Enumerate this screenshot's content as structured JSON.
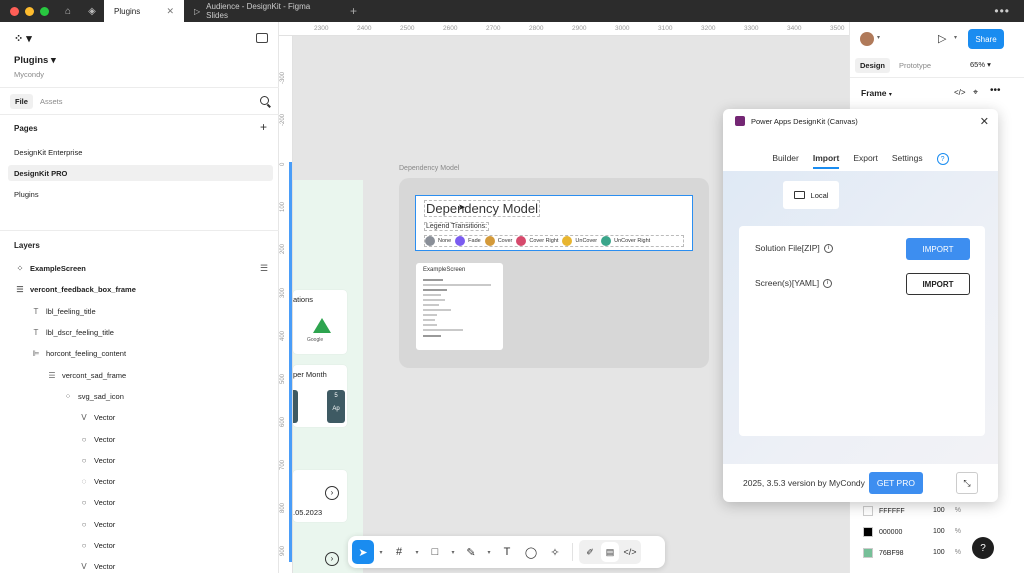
{
  "window": {
    "tabs": [
      {
        "label": "Plugins",
        "active": true
      },
      {
        "label": "Audience - DesignKit - Figma Slides",
        "active": false
      }
    ]
  },
  "file": {
    "name": "Plugins",
    "team": "Mycondy"
  },
  "left_tabs": {
    "file": "File",
    "assets": "Assets"
  },
  "pages": {
    "title": "Pages",
    "items": [
      "DesignKit Enterprise",
      "DesignKit PRO",
      "Plugins"
    ],
    "selected": "DesignKit PRO"
  },
  "layers": {
    "title": "Layers",
    "items": [
      {
        "name": "ExampleScreen",
        "icon": "component-grid-icon"
      },
      {
        "name": "vercont_feedback_box_frame",
        "icon": "frame-icon"
      },
      {
        "name": "lbl_feeling_title",
        "icon": "text-icon"
      },
      {
        "name": "lbl_dscr_feeling_title",
        "icon": "text-icon"
      },
      {
        "name": "horcont_feeling_content",
        "icon": "horizontal-layout-icon"
      },
      {
        "name": "vercont_sad_frame",
        "icon": "frame-icon"
      },
      {
        "name": "svg_sad_icon",
        "icon": "component-grid-icon"
      },
      {
        "name": "Vector",
        "icon": "vector-icon"
      },
      {
        "name": "Vector",
        "icon": "vector-icon"
      },
      {
        "name": "Vector",
        "icon": "vector-icon"
      },
      {
        "name": "Vector",
        "icon": "vector-icon"
      },
      {
        "name": "Vector",
        "icon": "vector-icon"
      },
      {
        "name": "Vector",
        "icon": "vector-icon"
      },
      {
        "name": "Vector",
        "icon": "vector-icon"
      },
      {
        "name": "Vector",
        "icon": "vector-icon"
      }
    ]
  },
  "canvas": {
    "ruler_top": [
      "2300",
      "2400",
      "2500",
      "2600",
      "2700",
      "2800",
      "2900",
      "3000",
      "3100",
      "3200",
      "3300",
      "3400",
      "3500"
    ],
    "ruler_left": [
      "-300",
      "-200",
      "0",
      "100",
      "200",
      "300",
      "400",
      "500",
      "600",
      "700",
      "800",
      "900"
    ],
    "frame_label": "Dependency Model",
    "dep_title": "Dependency Model",
    "legend_title": "Legend Transitions:",
    "legend": [
      {
        "label": "None",
        "color": "#8a8f98"
      },
      {
        "label": "Fade",
        "color": "#7b5cf0"
      },
      {
        "label": "Cover",
        "color": "#d49a3a"
      },
      {
        "label": "Cover Right",
        "color": "#d64a6c"
      },
      {
        "label": "UnCover",
        "color": "#e8b530"
      },
      {
        "label": "UnCover Right",
        "color": "#3aa58a"
      }
    ],
    "example_card_title": "ExampleScreen",
    "partial": {
      "ations": "ations",
      "google": "Google",
      "per_month": "per Month",
      "num": "5",
      "ap": "Ap",
      "date": ".05.2023"
    }
  },
  "toolbar": {
    "tools": [
      "move-tool-icon",
      "frame-tool-icon",
      "shape-tool-icon",
      "pen-tool-icon",
      "text-tool-icon",
      "comment-tool-icon",
      "actions-tool-icon"
    ]
  },
  "right": {
    "share": "Share",
    "tabs": {
      "design": "Design",
      "prototype": "Prototype"
    },
    "zoom": "65%",
    "section": "Frame",
    "fills": [
      {
        "hex": "FFFFFF",
        "pct": "100",
        "color": "#FFFFFF"
      },
      {
        "hex": "000000",
        "pct": "100",
        "color": "#000000"
      },
      {
        "hex": "76BF98",
        "pct": "100",
        "color": "#76BF98"
      }
    ],
    "pct_sign": "%",
    "help": "?"
  },
  "plugin": {
    "title": "Power Apps DesignKit (Canvas)",
    "tabs": [
      "Builder",
      "Import",
      "Export",
      "Settings"
    ],
    "active_tab": "Import",
    "help_icon": "?",
    "local": "Local",
    "rows": [
      {
        "label": "Solution File[ZIP]",
        "button": "IMPORT"
      },
      {
        "label": "Screen(s)[YAML]",
        "button": "IMPORT"
      }
    ],
    "footer": "2025, 3.5.3 version by MyCondy",
    "get_pro": "GET PRO",
    "accent": "#3d8ef0"
  }
}
